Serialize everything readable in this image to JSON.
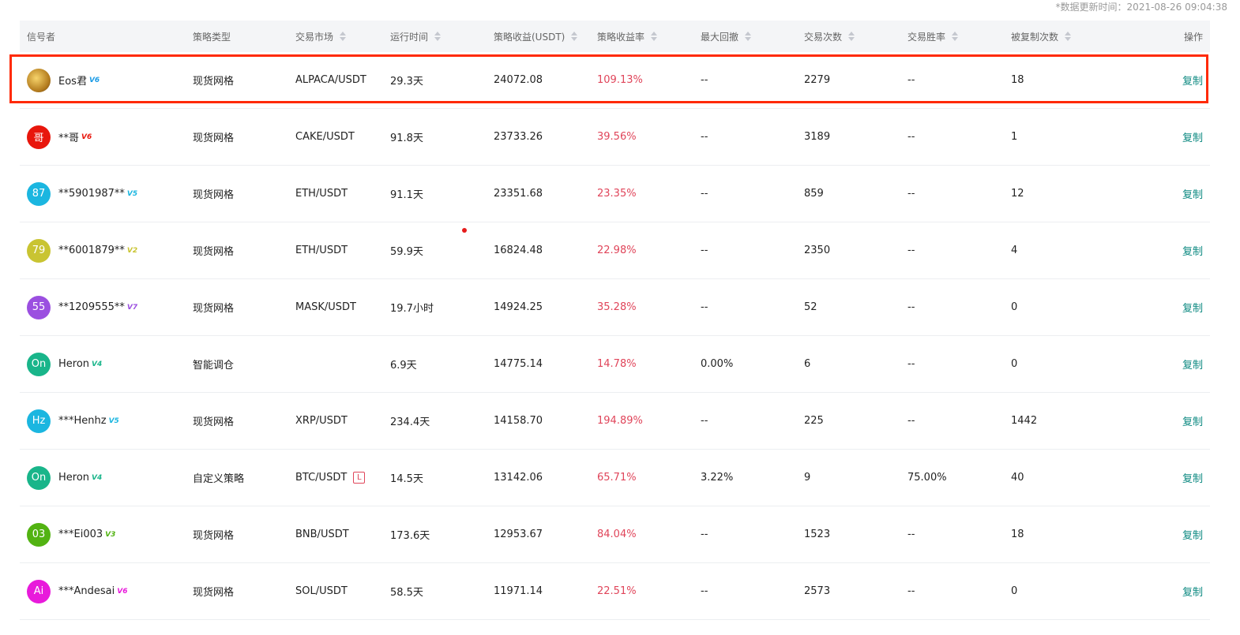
{
  "update_time": "*数据更新时间：2021-08-26 09:04:38",
  "headers": {
    "signaler": "信号者",
    "strategy_type": "策略类型",
    "market": "交易市场",
    "runtime": "运行时间",
    "profit": "策略收益(USDT)",
    "rate": "策略收益率",
    "max_drawdown": "最大回撤",
    "trades": "交易次数",
    "win_rate": "交易胜率",
    "copied": "被复制次数",
    "action": "操作"
  },
  "colors": {
    "accent": "#0e8a82",
    "rate_red": "#e0455a",
    "highlight_border": "#ff2a05"
  },
  "rows": [
    {
      "avatar_text": "",
      "avatar_color": "#b27a1d",
      "name": "Eos君",
      "vip": "V6",
      "vip_color": "#1a9be6",
      "type": "现货网格",
      "market": "ALPACA/USDT",
      "leverage": "",
      "runtime": "29.3天",
      "profit": "24072.08",
      "rate": "109.13%",
      "drawdown": "--",
      "trades": "2279",
      "win": "--",
      "copied": "18",
      "action": "复制"
    },
    {
      "avatar_text": "哥",
      "avatar_color": "#e8160c",
      "name": "**哥",
      "vip": "V6",
      "vip_color": "#e8160c",
      "type": "现货网格",
      "market": "CAKE/USDT",
      "leverage": "",
      "runtime": "91.8天",
      "profit": "23733.26",
      "rate": "39.56%",
      "drawdown": "--",
      "trades": "3189",
      "win": "--",
      "copied": "1",
      "action": "复制"
    },
    {
      "avatar_text": "87",
      "avatar_color": "#1bb6e0",
      "name": "**5901987**",
      "vip": "V5",
      "vip_color": "#1bb6e0",
      "type": "现货网格",
      "market": "ETH/USDT",
      "leverage": "",
      "runtime": "91.1天",
      "profit": "23351.68",
      "rate": "23.35%",
      "drawdown": "--",
      "trades": "859",
      "win": "--",
      "copied": "12",
      "action": "复制"
    },
    {
      "avatar_text": "79",
      "avatar_color": "#c9c432",
      "name": "**6001879**",
      "vip": "V2",
      "vip_color": "#c9c432",
      "type": "现货网格",
      "market": "ETH/USDT",
      "leverage": "",
      "runtime": "59.9天",
      "profit": "16824.48",
      "rate": "22.98%",
      "drawdown": "--",
      "trades": "2350",
      "win": "--",
      "copied": "4",
      "action": "复制"
    },
    {
      "avatar_text": "55",
      "avatar_color": "#9b4fe0",
      "name": "**1209555**",
      "vip": "V7",
      "vip_color": "#9b4fe0",
      "type": "现货网格",
      "market": "MASK/USDT",
      "leverage": "",
      "runtime": "19.7小时",
      "profit": "14924.25",
      "rate": "35.28%",
      "drawdown": "--",
      "trades": "52",
      "win": "--",
      "copied": "0",
      "action": "复制"
    },
    {
      "avatar_text": "On",
      "avatar_color": "#19b58a",
      "name": "Heron",
      "vip": "V4",
      "vip_color": "#19b58a",
      "type": "智能调仓",
      "market": "",
      "leverage": "",
      "runtime": "6.9天",
      "profit": "14775.14",
      "rate": "14.78%",
      "drawdown": "0.00%",
      "trades": "6",
      "win": "--",
      "copied": "0",
      "action": "复制"
    },
    {
      "avatar_text": "Hz",
      "avatar_color": "#1bb6e0",
      "name": "***Henhz",
      "vip": "V5",
      "vip_color": "#1bb6e0",
      "type": "现货网格",
      "market": "XRP/USDT",
      "leverage": "",
      "runtime": "234.4天",
      "profit": "14158.70",
      "rate": "194.89%",
      "drawdown": "--",
      "trades": "225",
      "win": "--",
      "copied": "1442",
      "action": "复制"
    },
    {
      "avatar_text": "On",
      "avatar_color": "#19b58a",
      "name": "Heron",
      "vip": "V4",
      "vip_color": "#19b58a",
      "type": "自定义策略",
      "market": "BTC/USDT",
      "leverage": "L",
      "runtime": "14.5天",
      "profit": "13142.06",
      "rate": "65.71%",
      "drawdown": "3.22%",
      "trades": "9",
      "win": "75.00%",
      "copied": "40",
      "action": "复制"
    },
    {
      "avatar_text": "03",
      "avatar_color": "#52b312",
      "name": "***Ei003",
      "vip": "V3",
      "vip_color": "#52b312",
      "type": "现货网格",
      "market": "BNB/USDT",
      "leverage": "",
      "runtime": "173.6天",
      "profit": "12953.67",
      "rate": "84.04%",
      "drawdown": "--",
      "trades": "1523",
      "win": "--",
      "copied": "18",
      "action": "复制"
    },
    {
      "avatar_text": "Ai",
      "avatar_color": "#e81adb",
      "name": "***Andesai",
      "vip": "V6",
      "vip_color": "#e81adb",
      "type": "现货网格",
      "market": "SOL/USDT",
      "leverage": "",
      "runtime": "58.5天",
      "profit": "11971.14",
      "rate": "22.51%",
      "drawdown": "--",
      "trades": "2573",
      "win": "--",
      "copied": "0",
      "action": "复制"
    }
  ]
}
